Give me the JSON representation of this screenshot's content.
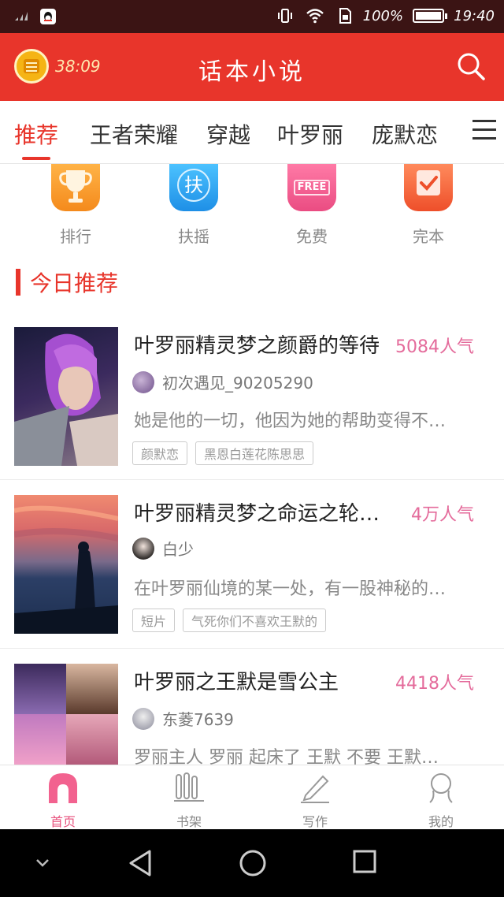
{
  "status_bar": {
    "battery_text": "100%",
    "battery_level": 1.0,
    "time": "19:40"
  },
  "header": {
    "timer": "38:09",
    "title": "话本小说"
  },
  "tabs": [
    {
      "label": "推荐",
      "active": true
    },
    {
      "label": "王者荣耀"
    },
    {
      "label": "穿越"
    },
    {
      "label": "叶罗丽"
    },
    {
      "label": "庞默恋"
    }
  ],
  "quick_entries": [
    {
      "label": "排行",
      "icon": "trophy-icon",
      "color": "#f79a2e"
    },
    {
      "label": "扶摇",
      "icon": "fuyao-icon",
      "glyph": "扶",
      "color": "#2aa7ef"
    },
    {
      "label": "免费",
      "icon": "free-sign-icon",
      "glyph": "FREE",
      "color": "#f05a8c"
    },
    {
      "label": "完本",
      "icon": "checkbox-icon",
      "color": "#f2603a"
    }
  ],
  "section": {
    "title": "今日推荐"
  },
  "books": [
    {
      "title": "叶罗丽精灵梦之颜爵的等待",
      "popularity": "5084人气",
      "author": "初次遇见_90205290",
      "desc": "她是他的一切，他因为她的帮助变得不…",
      "tags": [
        "颜默恋",
        "黑恩白莲花陈思思"
      ]
    },
    {
      "title": "叶罗丽精灵梦之命运之轮…",
      "popularity": "4万人气",
      "author": "白少",
      "desc": "在叶罗丽仙境的某一处，有一股神秘的…",
      "tags": [
        "短片",
        "气死你们不喜欢王默的"
      ]
    },
    {
      "title": "叶罗丽之王默是雪公主",
      "popularity": "4418人气",
      "author": "东菱7639",
      "desc": "罗丽主人 罗丽 起床了 王默 不要 王默…",
      "tags": []
    }
  ],
  "bottom_nav": [
    {
      "label": "首页",
      "icon": "home-icon",
      "active": true
    },
    {
      "label": "书架",
      "icon": "bookshelf-icon"
    },
    {
      "label": "写作",
      "icon": "pencil-icon"
    },
    {
      "label": "我的",
      "icon": "profile-icon"
    }
  ],
  "colors": {
    "brand_red": "#e8352b",
    "popularity_pink": "#e46b9b",
    "active_nav_pink": "#e8527e"
  }
}
